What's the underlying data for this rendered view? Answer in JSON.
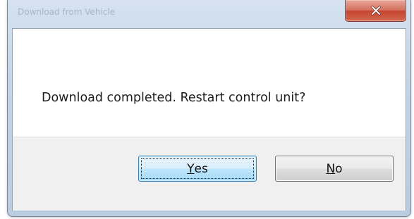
{
  "window": {
    "title": "Download from Vehicle"
  },
  "message": {
    "text": "Download completed. Restart control unit?"
  },
  "buttons": {
    "yes": {
      "accel": "Y",
      "rest": "es"
    },
    "no": {
      "accel": "N",
      "rest": "o"
    }
  },
  "icons": {
    "close": "close-icon"
  },
  "colors": {
    "close_button": "#c5452f",
    "default_button_border": "#3c7fb1",
    "button_bar": "#f0f0f0"
  }
}
